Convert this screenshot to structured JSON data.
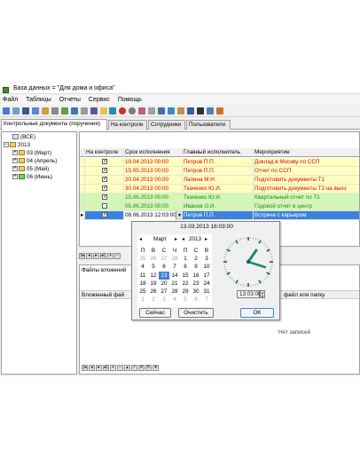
{
  "window": {
    "title": "База данных = \"Для дома и офиса\""
  },
  "menu": [
    "Файл",
    "Таблицы",
    "Отчеты",
    "Сервис",
    "Помощь"
  ],
  "tabs": [
    "Контрольные документы (поручения)",
    "На контроле",
    "Сотрудники",
    "Пользователи"
  ],
  "tree": {
    "all": "(ВСЕ)",
    "year": "2013",
    "months": [
      "03 (Март)",
      "04 (Апрель)",
      "05 (Май)",
      "06 (Июнь)"
    ]
  },
  "grid": {
    "columns": [
      "На контроле",
      "Срок исполнения",
      "Главный исполнитель",
      "Мероприятие"
    ],
    "rows": [
      {
        "checked": true,
        "date": "19.04.2013 00:00",
        "person": "Петров П.П.",
        "task": "Доклад в Москву по ССП",
        "style": "yel",
        "tcolor": "red"
      },
      {
        "checked": true,
        "date": "15.05.2013 00:00",
        "person": "Петров П.П.",
        "task": "Отчет по ССП",
        "style": "yel",
        "tcolor": "red"
      },
      {
        "checked": true,
        "date": "20.04.2013 00:00",
        "person": "Лапина М.Н.",
        "task": "Подготовить документы Т1",
        "style": "yel",
        "tcolor": "red"
      },
      {
        "checked": true,
        "date": "30.04.2013 00:00",
        "person": "Ткаченко Ю.И.",
        "task": "Подготовить документы Т2 на выез",
        "style": "yel",
        "tcolor": "red"
      },
      {
        "checked": true,
        "date": "15.06.2013 00:00",
        "person": "Ткаченко Ю.И.",
        "task": "Квартальный отчет по Т1",
        "style": "grn",
        "tcolor": "grn"
      },
      {
        "checked": false,
        "date": "05.06.2013 00:00",
        "person": "Иванов О.И.",
        "task": "Годовой отчет в центр",
        "style": "grn",
        "tcolor": "grn"
      },
      {
        "checked": true,
        "date": "08.06.2013 12:03:00",
        "person": "Петров П.П.",
        "task": "Встреча с карьером",
        "style": "sel",
        "tcolor": "sel"
      }
    ]
  },
  "lower": {
    "title": "Файлы вложений",
    "col1": "Вложенный фай",
    "col2": "файл или папку",
    "empty": "Нет записей"
  },
  "datepicker": {
    "header": "13.03.2013 16:03:00",
    "month": "Март",
    "year": "2013",
    "weekdays": [
      "П",
      "В",
      "С",
      "Ч",
      "П",
      "С",
      "В"
    ],
    "weeks": [
      [
        "25",
        "26",
        "27",
        "28",
        "1",
        "2",
        "3"
      ],
      [
        "4",
        "5",
        "6",
        "7",
        "8",
        "9",
        "10"
      ],
      [
        "11",
        "12",
        "13",
        "14",
        "15",
        "16",
        "17"
      ],
      [
        "18",
        "19",
        "20",
        "21",
        "22",
        "23",
        "24"
      ],
      [
        "25",
        "26",
        "27",
        "28",
        "29",
        "30",
        "31"
      ],
      [
        "1",
        "2",
        "3",
        "4",
        "5",
        "6",
        "7"
      ]
    ],
    "selected_day": "13",
    "time": "13:03:00",
    "today_label": "Сейчас",
    "clear_label": "Очистить",
    "ok_label": "OK"
  }
}
